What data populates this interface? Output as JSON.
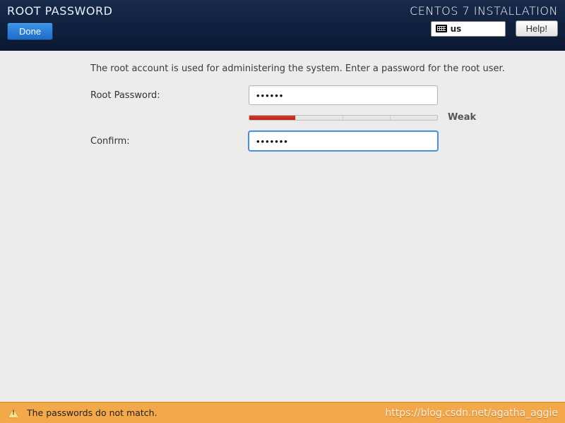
{
  "header": {
    "title": "ROOT PASSWORD",
    "app_title": "CENTOS 7 INSTALLATION",
    "done_label": "Done",
    "help_label": "Help!",
    "keyboard_layout": "us"
  },
  "main": {
    "description": "The root account is used for administering the system.  Enter a password for the root user.",
    "root_password_label": "Root Password:",
    "root_password_value": "••••••",
    "confirm_label": "Confirm:",
    "confirm_value": "•••••••",
    "strength_label": "Weak",
    "strength_filled_segments": 1,
    "strength_total_segments": 4
  },
  "footer": {
    "message": "The passwords do not match.",
    "watermark": "https://blog.csdn.net/agatha_aggie"
  }
}
